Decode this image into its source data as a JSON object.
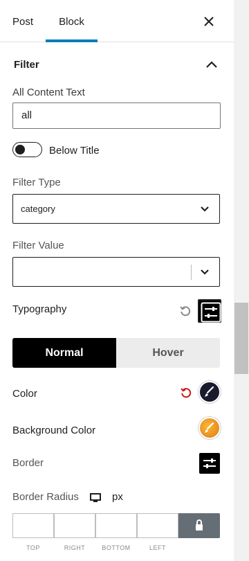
{
  "tabs": {
    "post": "Post",
    "block": "Block"
  },
  "panel": {
    "title": "Filter"
  },
  "all_content": {
    "label": "All Content Text",
    "value": "all"
  },
  "below_title": {
    "label": "Below Title",
    "enabled": false
  },
  "filter_type": {
    "label": "Filter Type",
    "value": "category"
  },
  "filter_value": {
    "label": "Filter Value",
    "value": ""
  },
  "typography": {
    "label": "Typography"
  },
  "state_tabs": {
    "normal": "Normal",
    "hover": "Hover",
    "active": "Normal"
  },
  "color": {
    "label": "Color",
    "swatch": "#1a1a2e",
    "reset_color": "#cc1818"
  },
  "background_color": {
    "label": "Background Color",
    "swatch": "#f0a020"
  },
  "border": {
    "label": "Border"
  },
  "border_radius": {
    "label": "Border Radius",
    "unit": "px",
    "sides": [
      "TOP",
      "RIGHT",
      "BOTTOM",
      "LEFT"
    ]
  },
  "colors": {
    "accent": "#007cba",
    "scrollbar_thumb": "#c1c1c1"
  }
}
